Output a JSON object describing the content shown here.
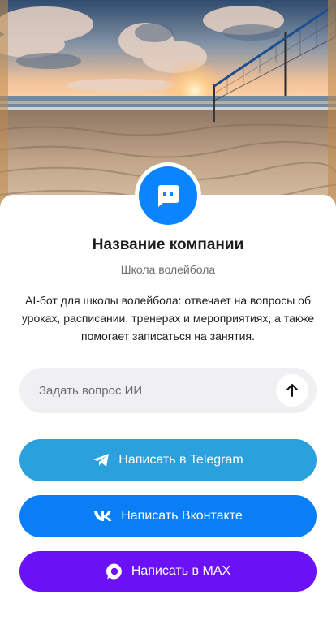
{
  "company": {
    "name": "Название компании",
    "subtitle": "Школа волейбола",
    "description": "AI-бот для школы волейбола: отвечает на вопросы об уроках, расписании, тренерах и мероприятиях, а также помогает записаться на занятия."
  },
  "ask": {
    "placeholder": "Задать вопрос ИИ"
  },
  "buttons": {
    "telegram": "Написать в Telegram",
    "vk": "Написать Вконтакте",
    "max": "Написать в MAX"
  },
  "colors": {
    "accent_blue": "#0a84ff",
    "telegram": "#2aa0dc",
    "vk": "#0a7ff5",
    "max": "#6a12f5"
  },
  "icons": {
    "avatar": "chat-bot-icon",
    "send": "arrow-up-icon",
    "telegram": "telegram-icon",
    "vk": "vk-icon",
    "max": "max-icon"
  }
}
